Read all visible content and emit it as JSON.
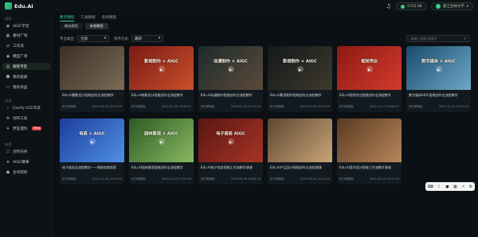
{
  "app": {
    "name": "Edu.AI"
  },
  "topbar": {
    "credits": "5722.94",
    "org": "浙江吉林大学"
  },
  "sidebar": {
    "sections": [
      {
        "label": "创作",
        "items": [
          {
            "label": "AIGC学堂",
            "icon": "bot-icon",
            "active": false
          },
          {
            "label": "素材广场",
            "icon": "grid-icon",
            "active": false
          },
          {
            "label": "工作流",
            "icon": "flow-icon",
            "active": false
          },
          {
            "label": "模型广场",
            "icon": "cube-icon",
            "active": false
          },
          {
            "label": "教程专区",
            "icon": "book-icon",
            "active": true
          },
          {
            "label": "我的班级",
            "icon": "users-icon",
            "active": false
          },
          {
            "label": "我的作品",
            "icon": "folder-icon",
            "active": false
          }
        ]
      },
      {
        "label": "应用",
        "items": [
          {
            "label": "Comfy UI工作流",
            "icon": "node-icon",
            "active": false
          },
          {
            "label": "创作工具",
            "icon": "tool-icon",
            "active": false
          },
          {
            "label": "梦笠漫作",
            "icon": "sparkle-icon",
            "active": false,
            "badge": "New"
          }
        ]
      },
      {
        "label": "应用",
        "items": [
          {
            "label": "创作任务",
            "icon": "task-icon",
            "active": false
          },
          {
            "label": "AIGC赛事",
            "icon": "trophy-icon",
            "active": false
          },
          {
            "label": "合作院校",
            "icon": "school-icon",
            "active": false
          }
        ]
      }
    ]
  },
  "main": {
    "tabs": [
      "教学教程",
      "工具教程",
      "名师教程"
    ],
    "subtabs": [
      "精选视频",
      "有效教程"
    ],
    "filters": {
      "type_label": "专业类型:",
      "type_value": "全部",
      "sort_label": "排序方式:",
      "sort_value": "最新"
    },
    "search_placeholder": "请输入搜索关键词",
    "cards": [
      {
        "title": "Edu.AI摄影设计智能创作全流程教学",
        "source": "官方教程组",
        "date": "2025-08-13 16:00:29",
        "overlay": "",
        "colors": [
          "#3b2f26",
          "#7a6a55"
        ]
      },
      {
        "title": "Edu.AI商影设计智能创作全流程教学",
        "source": "官方教程组",
        "date": "2025-02-08 19:59:02",
        "overlay": "影视制作 × AIGC",
        "colors": [
          "#7a1b15",
          "#c94f2b"
        ]
      },
      {
        "title": "Edu.AI动漫制作智能创作全流程教学",
        "source": "官方教程组",
        "date": "2026-02-22 21:52:00",
        "overlay": "动漫制作 × AIGC",
        "colors": [
          "#1c2b2c",
          "#5c4a3a"
        ]
      },
      {
        "title": "Edu.AI影视制作智能创作全流程教学",
        "source": "官方教程组",
        "date": "2025-02-02 09:15:09",
        "overlay": "影视制作 × AIGC",
        "colors": [
          "#14181a",
          "#3e3a2e"
        ]
      },
      {
        "title": "Edu.AI视觉传达智能创作全流程教学",
        "source": "官方教程组",
        "date": "2025-12-17 09:06:07",
        "overlay": "视觉传达",
        "colors": [
          "#8f1914",
          "#d23a2c"
        ]
      },
      {
        "title": "数字媒体AIGC智能创作全流程教学",
        "source": "官方教程组",
        "date": "2025-12-14 12:07:02",
        "overlay": "数字媒体 × AIGC",
        "colors": [
          "#1a4a6b",
          "#6fa8c8"
        ]
      },
      {
        "title": "电子商务全流程教学——帮助电商商家",
        "source": "官方教程组",
        "date": "2025-11-26 13:00:32",
        "overlay": "电商 × AIGC",
        "colors": [
          "#1d3f9a",
          "#4f8fe6"
        ]
      },
      {
        "title": "Edu.AI园林景观智能创作全流程教学",
        "source": "官方教程组",
        "date": "2025-11-20 17:20:46",
        "overlay": "园林景观 × AIGC",
        "colors": [
          "#2e5a25",
          "#88b860"
        ]
      },
      {
        "title": "Edu.AI电子商务智能工作流教学课课",
        "source": "官方教程组",
        "date": "2025-08-26 16:06:16",
        "overlay": "电子商务 AIGC",
        "colors": [
          "#5a1612",
          "#a83426"
        ]
      },
      {
        "title": "Edu.AI产品设计智能创作全流程课课",
        "source": "官方教程组",
        "date": "2025-08-19 14:10:41",
        "overlay": "",
        "colors": [
          "#5e4630",
          "#c9a478"
        ]
      },
      {
        "title": "Edu.AI室内设计智能工作流教学课课",
        "source": "官方教程组",
        "date": "2025-08-15 15:10:00",
        "overlay": "",
        "colors": [
          "#5a3a22",
          "#b7865a"
        ]
      }
    ]
  }
}
